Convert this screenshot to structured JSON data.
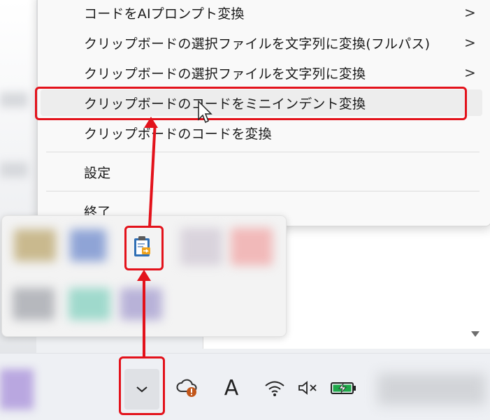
{
  "menu": {
    "items": [
      {
        "label": "コードをAIプロンプト変換",
        "has_submenu": true
      },
      {
        "label": "クリップボードの選択ファイルを文字列に変換(フルパス)",
        "has_submenu": true
      },
      {
        "label": "クリップボードの選択ファイルを文字列に変換",
        "has_submenu": true
      },
      {
        "label": "クリップボードのコードをミニインデント変換",
        "has_submenu": false
      },
      {
        "label": "クリップボードのコードを変換",
        "has_submenu": false
      }
    ],
    "settings_label": "設定",
    "exit_label": "終了",
    "submenu_glyph": ">"
  },
  "taskbar": {
    "show_hidden_glyph": "⌄",
    "ime_glyph": "A",
    "icons": [
      "chevron-down-icon",
      "onedrive-warning-icon",
      "ime-mode-icon",
      "wifi-icon",
      "volume-muted-icon",
      "battery-charging-icon"
    ]
  },
  "colors": {
    "highlight": "#e3121b",
    "battery": "#1fa84a",
    "warning": "#c2561a"
  }
}
